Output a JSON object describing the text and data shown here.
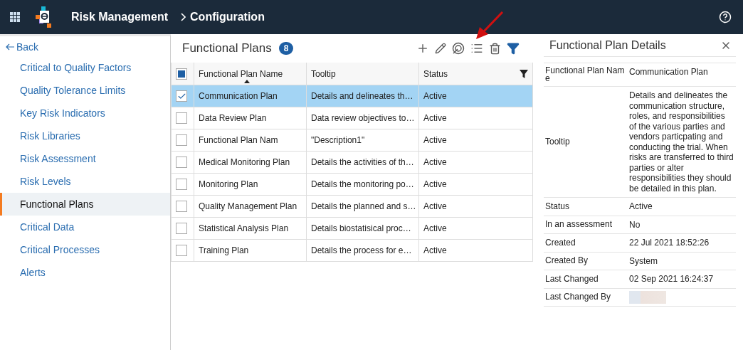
{
  "header": {
    "app_title": "Risk Management",
    "breadcrumb": "Configuration"
  },
  "sidebar": {
    "back": "Back",
    "items": [
      {
        "label": "Critical to Quality Factors",
        "selected": false
      },
      {
        "label": "Quality Tolerance Limits",
        "selected": false
      },
      {
        "label": "Key Risk Indicators",
        "selected": false
      },
      {
        "label": "Risk Libraries",
        "selected": false
      },
      {
        "label": "Risk Assessment",
        "selected": false
      },
      {
        "label": "Risk Levels",
        "selected": false
      },
      {
        "label": "Functional Plans",
        "selected": true
      },
      {
        "label": "Critical Data",
        "selected": false
      },
      {
        "label": "Critical Processes",
        "selected": false
      },
      {
        "label": "Alerts",
        "selected": false
      }
    ]
  },
  "list": {
    "title": "Functional Plans",
    "count": "8",
    "select_all": {
      "indeterminate": true
    },
    "columns": [
      {
        "label": "Functional Plan Name",
        "sorted": true
      },
      {
        "label": "Tooltip",
        "sorted": false
      },
      {
        "label": "Status",
        "sorted": false
      }
    ],
    "rows": [
      {
        "name": "Communication Plan",
        "tooltip": "Details and delineates th…",
        "status": "Active",
        "checked": true,
        "selected": true
      },
      {
        "name": "Data Review Plan",
        "tooltip": "Data review objectives to…",
        "status": "Active",
        "checked": false,
        "selected": false
      },
      {
        "name": "Functional Plan Nam",
        "tooltip": "\"Description1\"",
        "status": "Active",
        "checked": false,
        "selected": false
      },
      {
        "name": "Medical Monitoring Plan",
        "tooltip": "Details the activities of th…",
        "status": "Active",
        "checked": false,
        "selected": false
      },
      {
        "name": "Monitoring Plan",
        "tooltip": "Details the monitoring po…",
        "status": "Active",
        "checked": false,
        "selected": false
      },
      {
        "name": "Quality Management Plan",
        "tooltip": "Details the planned and s…",
        "status": "Active",
        "checked": false,
        "selected": false
      },
      {
        "name": "Statistical Analysis Plan",
        "tooltip": "Details biostatisical proc…",
        "status": "Active",
        "checked": false,
        "selected": false
      },
      {
        "name": "Training Plan",
        "tooltip": "Details the process for e…",
        "status": "Active",
        "checked": false,
        "selected": false
      }
    ]
  },
  "details": {
    "title": "Functional Plan Details",
    "fields": [
      {
        "label": "Functional Plan Name",
        "value": "Communication Plan"
      },
      {
        "label": "Tooltip",
        "value": "Details and delineates the communication structure, roles, and responsibilities of the various parties and vendors particpating and conducting the trial. When risks are transferred to third parties or alter responsibilities they should be detailed in this plan."
      },
      {
        "label": "Status",
        "value": "Active"
      },
      {
        "label": "In an assessment",
        "value": "No"
      },
      {
        "label": "Created",
        "value": "22 Jul 2021 18:52:26"
      },
      {
        "label": "Created By",
        "value": "System"
      },
      {
        "label": "Last Changed",
        "value": "02 Sep 2021 16:24:37"
      },
      {
        "label": "Last Changed By",
        "kind": "redacted"
      }
    ]
  }
}
